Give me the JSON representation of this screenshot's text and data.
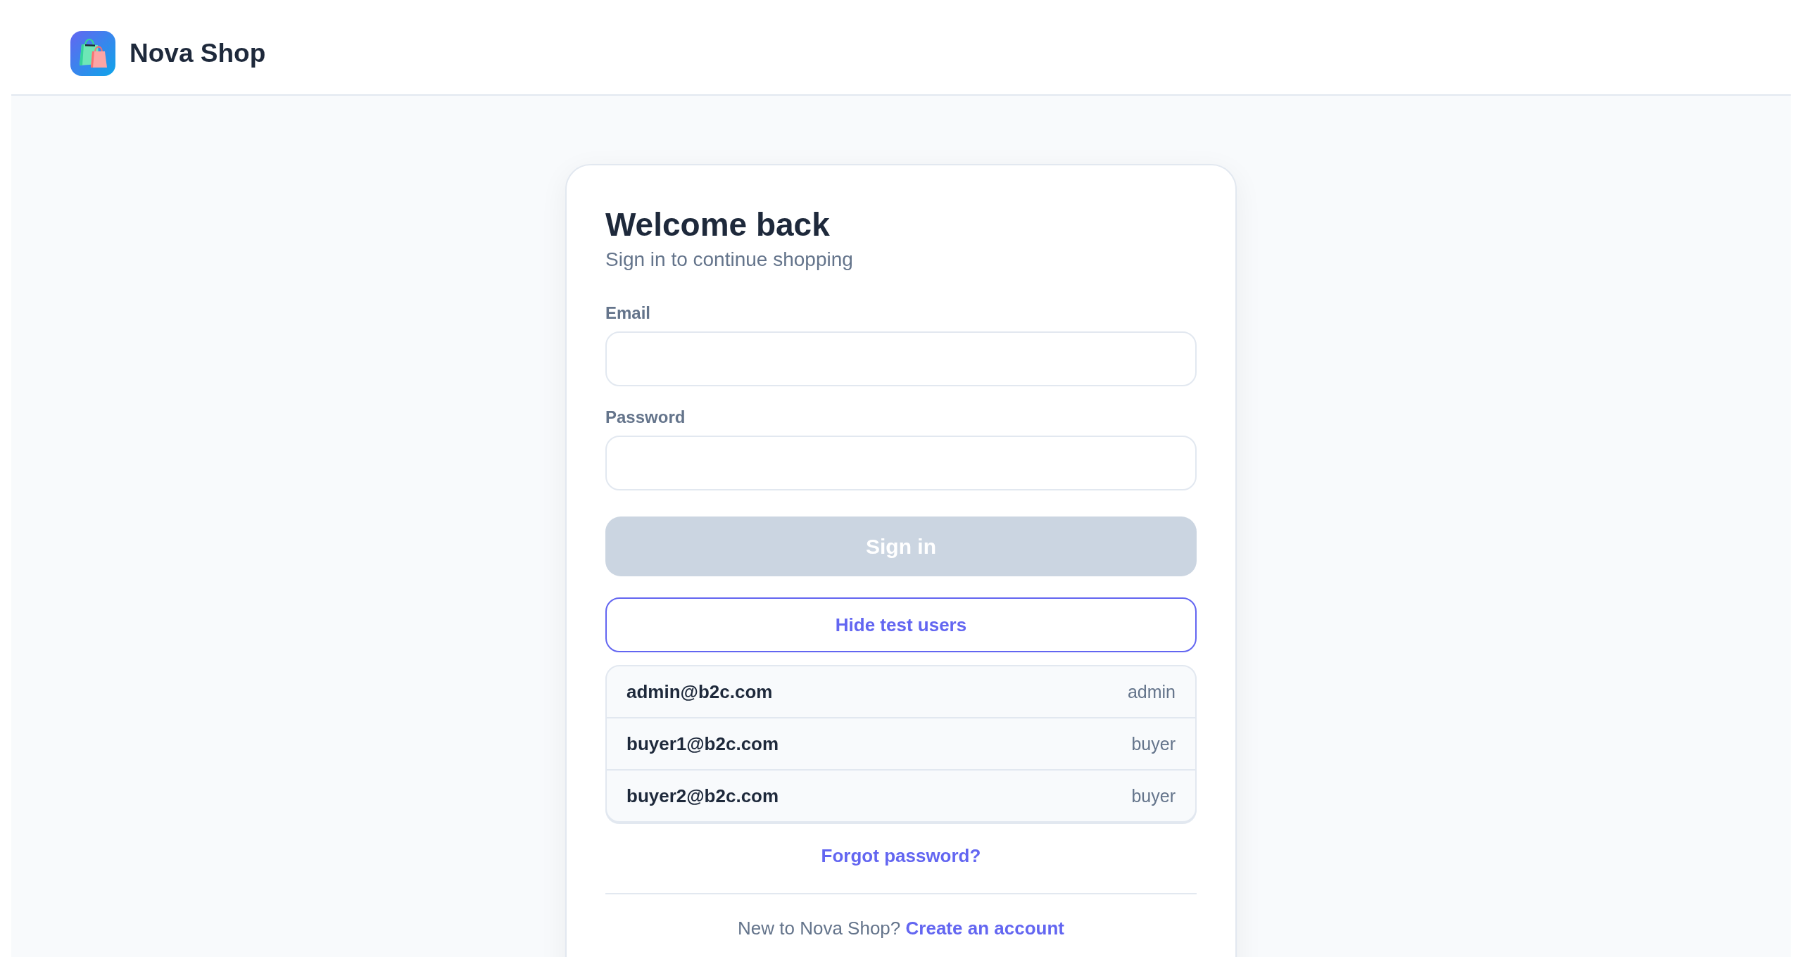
{
  "header": {
    "brand": "Nova Shop"
  },
  "card": {
    "title": "Welcome back",
    "subtitle": "Sign in to continue shopping",
    "fields": [
      {
        "label": "Email"
      },
      {
        "label": "Password"
      }
    ],
    "submit": {
      "label": "Sign in",
      "disabled": true
    },
    "toggle_test_users": {
      "label": "Hide test users"
    },
    "test_users": [
      {
        "email": "admin@b2c.com",
        "role": "admin"
      },
      {
        "email": "buyer1@b2c.com",
        "role": "buyer"
      },
      {
        "email": "buyer2@b2c.com",
        "role": "buyer"
      }
    ],
    "forgot_link": "Forgot password?",
    "signup": {
      "prompt": "New to Nova Shop?",
      "link": "Create an account"
    }
  }
}
